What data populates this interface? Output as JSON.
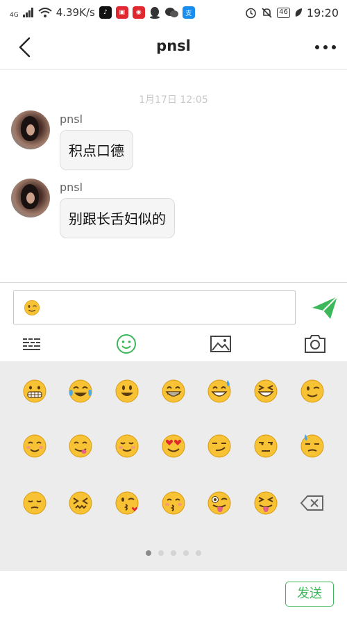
{
  "status_bar": {
    "network_type": "4G",
    "net_speed": "4.39K/s",
    "battery": "46",
    "time": "19:20"
  },
  "nav": {
    "title": "pnsl"
  },
  "chat": {
    "timestamp": "1月17日 12:05",
    "messages": [
      {
        "sender": "pnsl",
        "text": "积点口德"
      },
      {
        "sender": "pnsl",
        "text": "别跟长舌妇似的"
      }
    ]
  },
  "input": {
    "current_value_icon": "wink-emoji"
  },
  "toolbar": {
    "icons": [
      "keyboard-icon",
      "emoji-icon",
      "image-icon",
      "camera-icon"
    ]
  },
  "emoji_panel": {
    "rows": [
      [
        "grimacing",
        "joy-tears",
        "smiley",
        "grin",
        "sweat-smile",
        "laughing",
        "wink"
      ],
      [
        "blush",
        "yum",
        "relieved",
        "heart-eyes",
        "smirk",
        "unamused",
        "downcast-sweat"
      ],
      [
        "pensive",
        "confounded",
        "kissing-heart",
        "kissing-closed-eyes",
        "stuck-out-tongue-wink",
        "stuck-out-tongue-closed-eyes",
        "backspace"
      ]
    ],
    "page_count": 5,
    "active_page": 1
  },
  "bottom": {
    "send_label": "发送"
  },
  "colors": {
    "accent_green": "#3cb75a",
    "emoji_yellow": "#f7c234",
    "panel_bg": "#ececec"
  }
}
